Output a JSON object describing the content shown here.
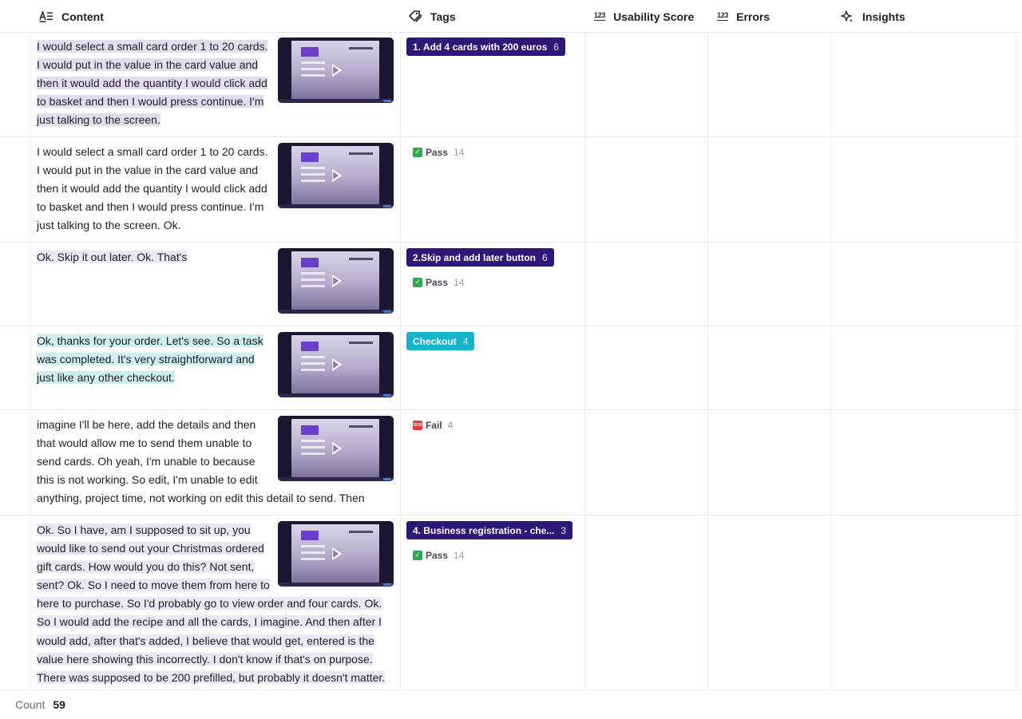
{
  "columns": {
    "content": {
      "label": "Content",
      "icon": "text-align-icon"
    },
    "tags": {
      "label": "Tags",
      "icon": "tag-icon"
    },
    "usability": {
      "label": "Usability Score",
      "icon": "number-icon",
      "icon_text": "123"
    },
    "errors": {
      "label": "Errors",
      "icon": "number-icon",
      "icon_text": "123"
    },
    "insights": {
      "label": "Insights",
      "icon": "sparkle-icon"
    }
  },
  "rows": [
    {
      "text": "I would select a small card order 1 to 20 cards. I would put in the value in the card value and then it would add the quantity I would click add to basket and then I would press continue. I'm just talking to the screen.",
      "tags": [
        {
          "label": "1. Add 4 cards with 200 euros",
          "count": "6",
          "color": "#2e1777"
        }
      ],
      "statuses": []
    },
    {
      "text": "I would select a small card order 1 to 20 cards. I would put in the value in the card value and then it would add the quantity I would click add to basket and then I would press continue. I'm just talking to the screen. Ok.",
      "tags": [],
      "statuses": [
        {
          "label": "Pass",
          "count": "14"
        }
      ]
    },
    {
      "text": "Ok. Skip it out later. Ok. That's",
      "tags": [
        {
          "label": "2.Skip and add later button",
          "count": "6",
          "color": "#2e1777"
        }
      ],
      "statuses": [
        {
          "label": "Pass",
          "count": "14"
        }
      ]
    },
    {
      "text": "Ok, thanks for your order. Let's see. So a task was completed. It's very straightforward and just like any other checkout.",
      "tags": [
        {
          "label": "Checkout",
          "count": "4",
          "color": "#12b5c9"
        }
      ],
      "statuses": []
    },
    {
      "text": "imagine I'll be here, add the details and then that would allow me to send them unable to send cards. Oh yeah, I'm unable to because this is not working. So edit, I'm unable to edit anything, project time, not working on edit this detail to send. Then",
      "tags": [],
      "statuses": [
        {
          "label": "Fail",
          "count": "4"
        }
      ]
    },
    {
      "text": "Ok. So I have, am I supposed to sit up, you would like to send out your Christmas ordered gift cards. How would you do this? Not sent, sent? Ok. So I need to move them from here to here to purchase. So I'd probably go to view order and four cards. Ok. So I would add the recipe and all the cards, I imagine. And then after I would add, after that's added, I believe that would get, entered is the value here showing this incorrectly. I don't know if that's on purpose. There was supposed to be 200 prefilled, but probably it doesn't matter.",
      "tags": [
        {
          "label": "4. Business registration - che...",
          "count": "3",
          "color": "#2e1777"
        }
      ],
      "statuses": [
        {
          "label": "Pass",
          "count": "14"
        }
      ]
    }
  ],
  "footer": {
    "label": "Count",
    "value": "59"
  }
}
